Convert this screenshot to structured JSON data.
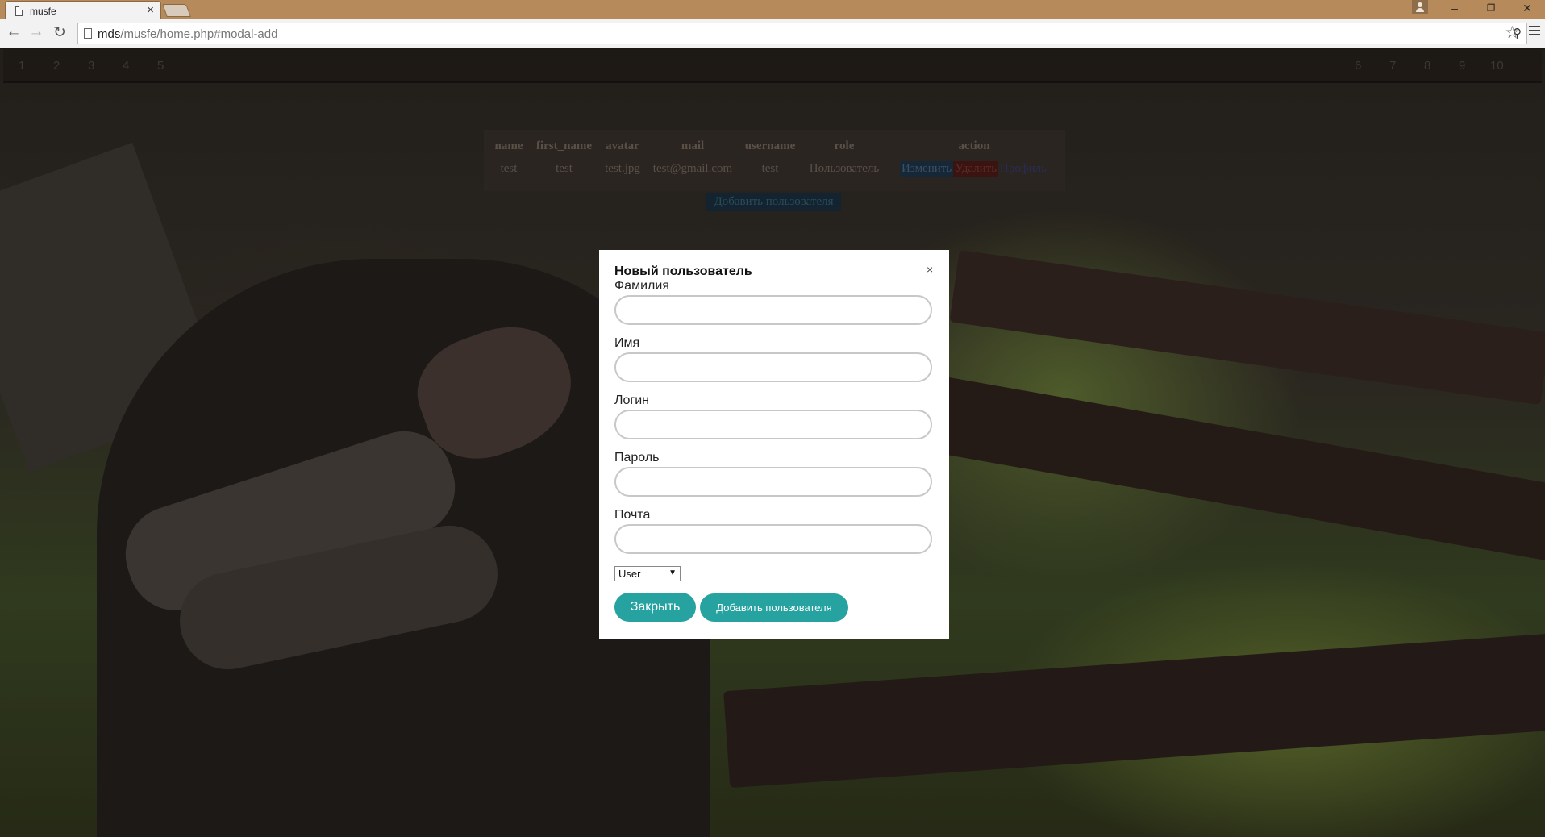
{
  "browser": {
    "tab_title": "musfe",
    "tab_close": "×",
    "url_host": "mds",
    "url_path": "/musfe/home.php#modal-add"
  },
  "pager": {
    "numbers": [
      "1",
      "2",
      "3",
      "4",
      "5",
      "6",
      "7",
      "8",
      "9",
      "10"
    ]
  },
  "table": {
    "headers": [
      "name",
      "first_name",
      "avatar",
      "mail",
      "username",
      "role",
      "action"
    ],
    "rows": [
      {
        "name": "test",
        "first_name": "test",
        "avatar": "test.jpg",
        "mail": "test@gmail.com",
        "username": "test",
        "role": "Пользователь",
        "edit": "Изменить",
        "delete": "Удалить",
        "profile": "Профиль"
      }
    ],
    "add_button": "Добавить пользователя"
  },
  "modal": {
    "title": "Новый пользователь",
    "close_icon": "×",
    "fields": [
      {
        "label": "Фамилия",
        "value": ""
      },
      {
        "label": "Имя",
        "value": ""
      },
      {
        "label": "Логин",
        "value": ""
      },
      {
        "label": "Пароль",
        "value": ""
      },
      {
        "label": "Почта",
        "value": ""
      }
    ],
    "role_select": {
      "selected": "User"
    },
    "close_button": "Закрыть",
    "submit_button": "Добавить пользователя"
  },
  "colors": {
    "accent": "#26a2a0",
    "titlebar": "#b68a5a"
  }
}
